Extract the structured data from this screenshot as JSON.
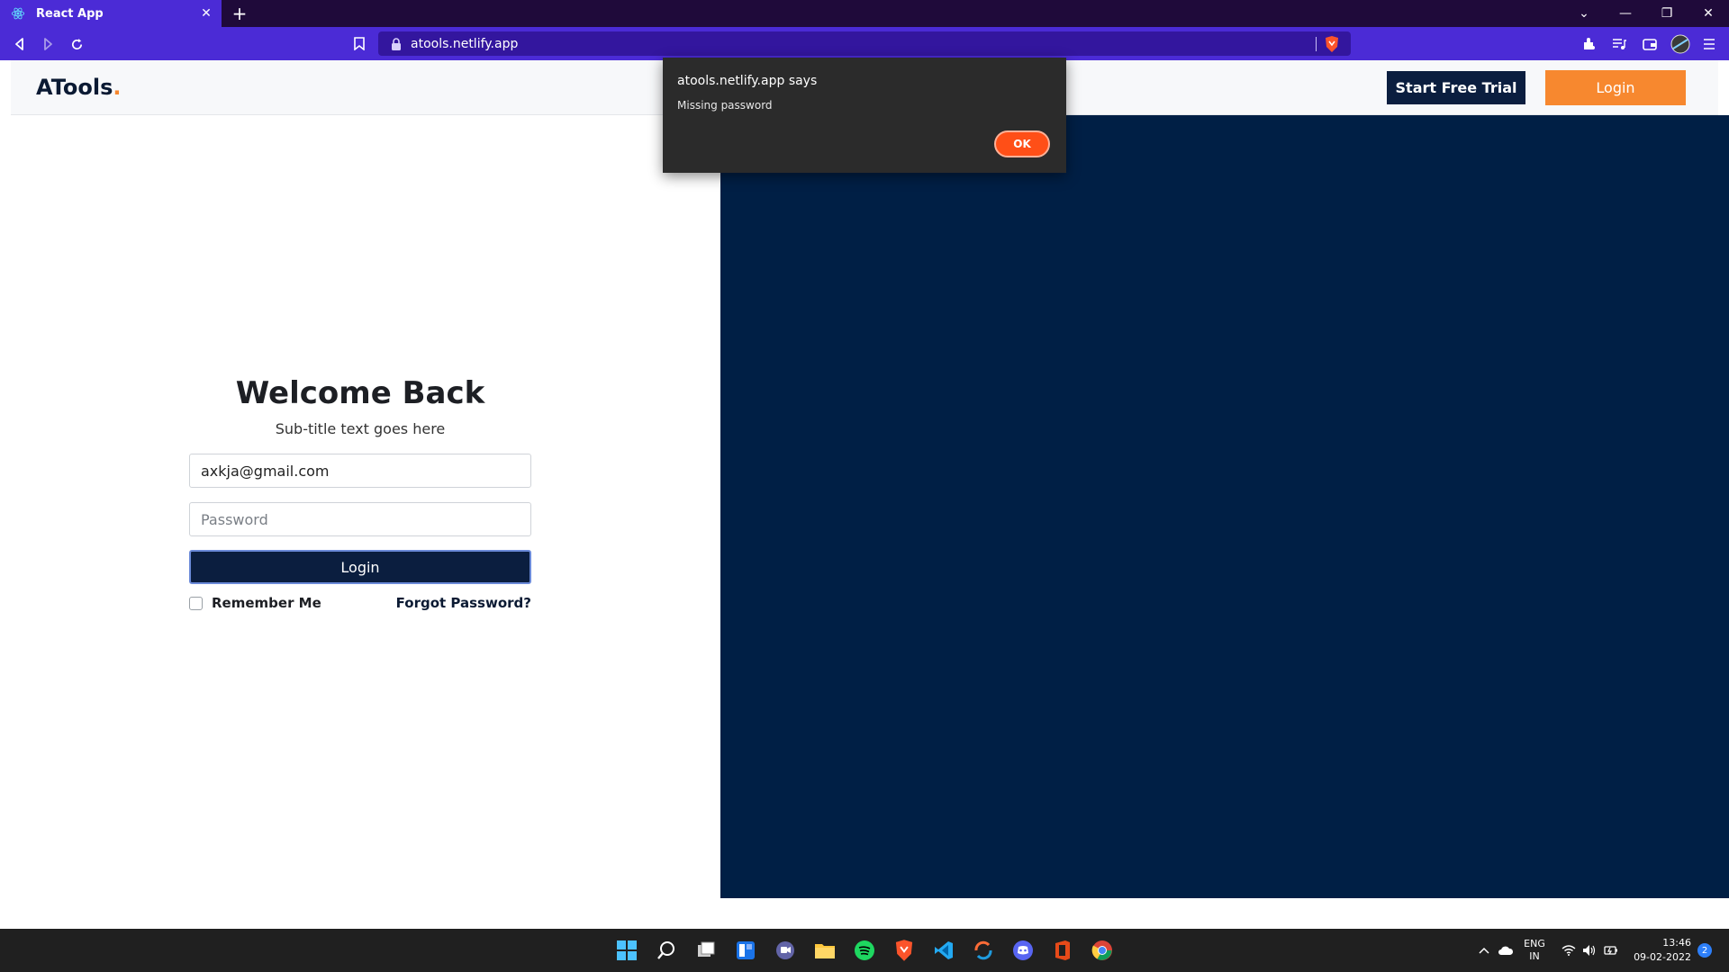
{
  "browser": {
    "tab_title": "React App",
    "tab_close": "✕",
    "new_tab": "+",
    "url": "atools.netlify.app",
    "window_controls": {
      "dropdown": "⌄",
      "minimize": "—",
      "restore": "❐",
      "close": "✕"
    }
  },
  "site": {
    "logo_text": "ATools",
    "logo_dot": ".",
    "start_trial_label": "Start Free Trial",
    "login_top_label": "Login"
  },
  "login_form": {
    "heading": "Welcome Back",
    "subtitle": "Sub-title text goes here",
    "email_value": "axkja@gmail.com",
    "password_placeholder": "Password",
    "login_button": "Login",
    "remember_label": "Remember Me",
    "forgot_label": "Forgot Password?"
  },
  "dialog": {
    "title": "atools.netlify.app says",
    "message": "Missing password",
    "ok_label": "OK"
  },
  "taskbar": {
    "lang_top": "ENG",
    "lang_bottom": "IN",
    "time": "13:46",
    "date": "09-02-2022",
    "notification_count": "2"
  },
  "colors": {
    "browser_accent": "#4b2bd6",
    "navy": "#0b1e3f",
    "orange": "#f7882f",
    "panel": "#001f45",
    "dialog_ok": "#ff4f17"
  }
}
